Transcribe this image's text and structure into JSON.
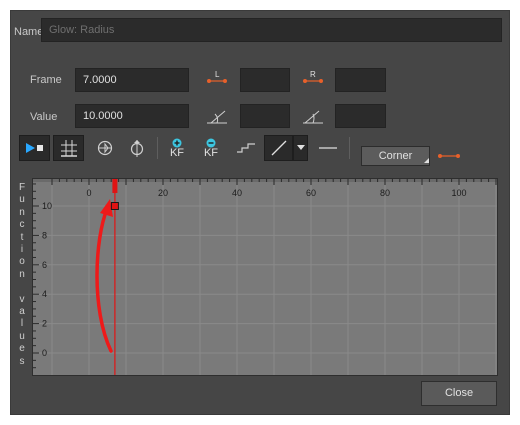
{
  "name_label": "Name",
  "name_value": "Glow: Radius",
  "frame_label": "Frame",
  "frame_value": "7.0000",
  "value_label": "Value",
  "value_value": "10.0000",
  "left_handle_tag": "L",
  "right_handle_tag": "R",
  "toolbar": {
    "add_kf_text": "KF",
    "remove_kf_text": "KF",
    "interpolation_label": "Corner"
  },
  "y_axis_title": [
    "F",
    "u",
    "n",
    "c",
    "t",
    "i",
    "o",
    "n",
    " ",
    "v",
    "a",
    "l",
    "u",
    "e",
    "s"
  ],
  "x_ticks": [
    "0",
    "20",
    "40",
    "60",
    "80",
    "100"
  ],
  "y_ticks": [
    "10",
    "8",
    "6",
    "4",
    "2",
    "0"
  ],
  "current_frame": 7,
  "keyframe": {
    "frame": 7,
    "value": 10
  },
  "colors": {
    "accent": "#e8602a",
    "keyframe_red": "#e01414",
    "teal": "#3cc6e0",
    "play_blue": "#29a8ff"
  },
  "close_label": "Close"
}
